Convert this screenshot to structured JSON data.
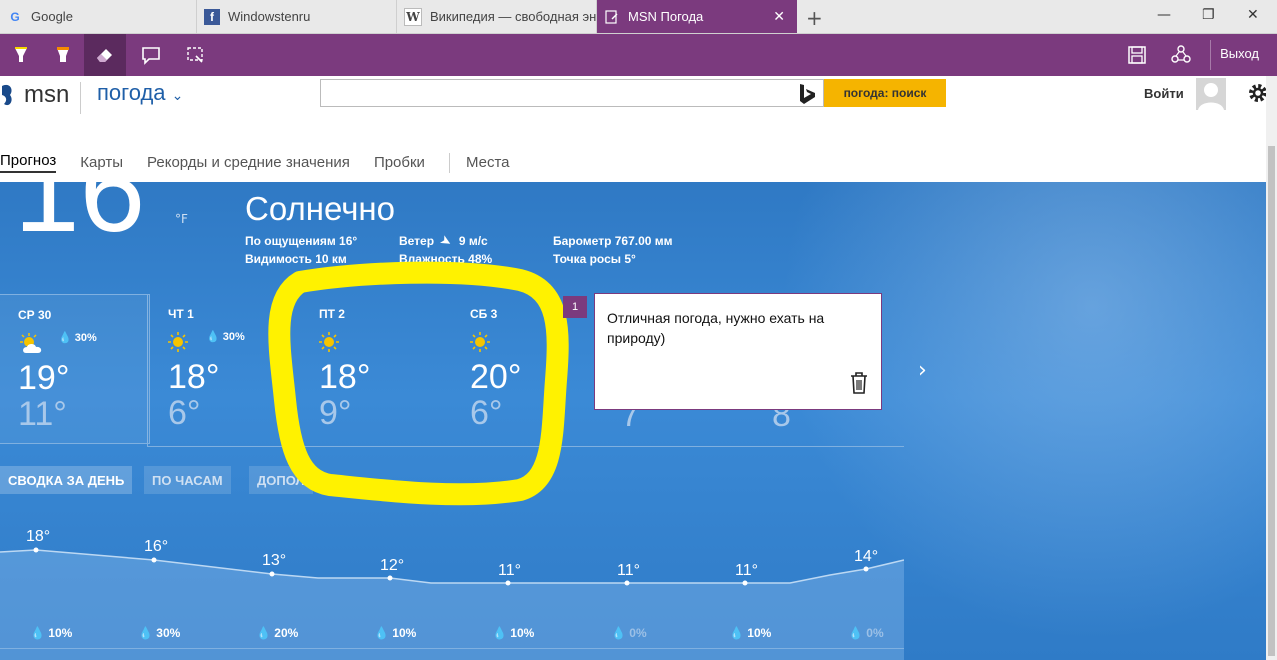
{
  "browser": {
    "tabs": [
      {
        "label": "Google",
        "favicon": "G"
      },
      {
        "label": "Windowstenru",
        "favicon": "f"
      },
      {
        "label": "Википедия — свободная эн",
        "favicon": "W"
      },
      {
        "label": "MSN Погода",
        "favicon": ""
      }
    ]
  },
  "notebar": {
    "exit_label": "Выход"
  },
  "header": {
    "logo": "msn",
    "section": "погода",
    "search_button": "погода: поиск",
    "signin": "Войти"
  },
  "nav": [
    "Прогноз",
    "Карты",
    "Рекорды и средние значения",
    "Пробки",
    "Места"
  ],
  "current": {
    "temp": "16",
    "unit_c": "°",
    "unit_f": "°F",
    "condition": "Солнечно",
    "feels_like": "По ощущениям 16°",
    "visibility": "Видимость 10 км",
    "wind_label": "Ветер",
    "wind_value": "9 м/с",
    "humidity": "Влажность 48%",
    "pressure": "Барометр 767.00 мм",
    "dew_point": "Точка росы 5°"
  },
  "days": [
    {
      "name": "СР 30",
      "precip": "30%",
      "hi": "19°",
      "lo": "11°",
      "icon": "partly-sunny"
    },
    {
      "name": "ЧТ 1",
      "precip": "30%",
      "hi": "18°",
      "lo": "6°",
      "icon": "sunny"
    },
    {
      "name": "ПТ 2",
      "precip": "",
      "hi": "18°",
      "lo": "9°",
      "icon": "sunny"
    },
    {
      "name": "СБ 3",
      "precip": "",
      "hi": "20°",
      "lo": "6°",
      "icon": "sunny"
    }
  ],
  "hidden_lows": [
    "7",
    "8"
  ],
  "views": [
    "СВОДКА ЗА ДЕНЬ",
    "ПО ЧАСАМ",
    "ДОПОЛ"
  ],
  "hourly": {
    "temps": [
      "18°",
      "16°",
      "13°",
      "12°",
      "11°",
      "11°",
      "11°",
      "14°"
    ],
    "precip": [
      "10%",
      "30%",
      "20%",
      "10%",
      "10%",
      "0%",
      "10%",
      "0%"
    ]
  },
  "note": {
    "badge": "1",
    "text": "Отличная погода, нужно ехать на природу)"
  },
  "colors": {
    "accent": "#7b3a7e",
    "highlight": "#fff200",
    "search": "#f5b400"
  }
}
